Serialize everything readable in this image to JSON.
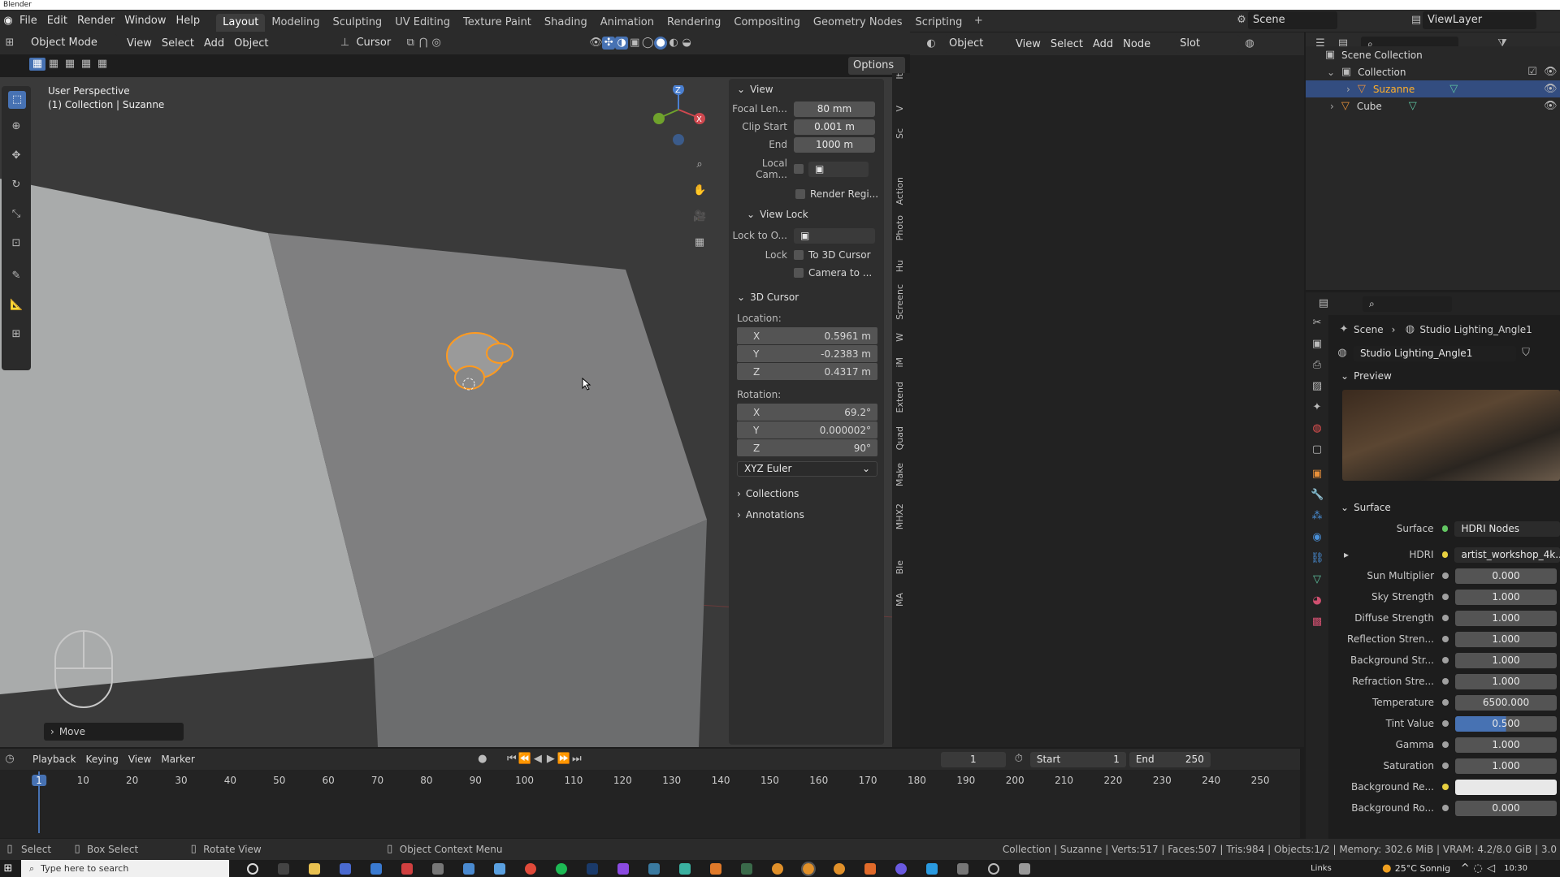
{
  "app_title": "Blender",
  "menus": [
    "File",
    "Edit",
    "Render",
    "Window",
    "Help"
  ],
  "workspaces": [
    "Layout",
    "Modeling",
    "Sculpting",
    "UV Editing",
    "Texture Paint",
    "Shading",
    "Animation",
    "Rendering",
    "Compositing",
    "Geometry Nodes",
    "Scripting"
  ],
  "active_workspace": "Layout",
  "scene_name": "Scene",
  "view_layer": "ViewLayer",
  "viewport_header": {
    "mode": "Object Mode",
    "menus": [
      "View",
      "Select",
      "Add",
      "Object"
    ],
    "pivot": "Cursor",
    "options": "Options"
  },
  "viewport": {
    "perspective": "User Perspective",
    "collection": "(1) Collection | Suzanne",
    "operator": "Move"
  },
  "npanel": {
    "view_title": "View",
    "focal_label": "Focal Len...",
    "focal_value": "80 mm",
    "clip_start_label": "Clip Start",
    "clip_start_value": "0.001 m",
    "end_label": "End",
    "end_value": "1000 m",
    "local_cam_label": "Local Cam...",
    "render_region": "Render Regi...",
    "view_lock_title": "View Lock",
    "lock_to_label": "Lock to O...",
    "lock_label": "Lock",
    "to_3d_cursor": "To 3D Cursor",
    "camera_to": "Camera to ...",
    "cursor_title": "3D Cursor",
    "location_label": "Location:",
    "loc": [
      {
        "axis": "X",
        "value": "0.5961 m"
      },
      {
        "axis": "Y",
        "value": "-0.2383 m"
      },
      {
        "axis": "Z",
        "value": "0.4317 m"
      }
    ],
    "rotation_label": "Rotation:",
    "rot": [
      {
        "axis": "X",
        "value": "69.2°"
      },
      {
        "axis": "Y",
        "value": "0.000002°"
      },
      {
        "axis": "Z",
        "value": "90°"
      }
    ],
    "rot_mode": "XYZ Euler",
    "collections": "Collections",
    "annotations": "Annotations"
  },
  "side_tabs": [
    "It",
    "V",
    "Sc",
    "Action",
    "Photo",
    "Hu",
    "Screenc",
    "W",
    "iM",
    "Extend",
    "Quad",
    "Make",
    "MHX2",
    "Ble",
    "MA"
  ],
  "node_header": {
    "type": "Object",
    "menus": [
      "View",
      "Select",
      "Add",
      "Node"
    ],
    "slot": "Slot"
  },
  "outliner": {
    "root": "Scene Collection",
    "collection": "Collection",
    "items": [
      "Suzanne",
      "Cube"
    ]
  },
  "properties": {
    "breadcrumb_scene": "Scene",
    "breadcrumb_world": "Studio Lighting_Angle1",
    "world_name": "Studio Lighting_Angle1",
    "preview": "Preview",
    "surface_panel": "Surface",
    "surface_label": "Surface",
    "surface_value": "HDRI Nodes",
    "hdri_label": "HDRI",
    "hdri_value": "artist_workshop_4k....",
    "rows": [
      {
        "label": "Sun Multiplier",
        "value": "0.000"
      },
      {
        "label": "Sky Strength",
        "value": "1.000"
      },
      {
        "label": "Diffuse Strength",
        "value": "1.000"
      },
      {
        "label": "Reflection Stren...",
        "value": "1.000"
      },
      {
        "label": "Background Str...",
        "value": "1.000"
      },
      {
        "label": "Refraction Stre...",
        "value": "1.000"
      },
      {
        "label": "Temperature",
        "value": "6500.000"
      },
      {
        "label": "Tint Value",
        "value": "0.500"
      },
      {
        "label": "Gamma",
        "value": "1.000"
      },
      {
        "label": "Saturation",
        "value": "1.000"
      },
      {
        "label": "Background Re...",
        "value": ""
      },
      {
        "label": "Background Ro...",
        "value": "0.000"
      }
    ]
  },
  "timeline": {
    "menus": [
      "Playback",
      "Keying",
      "View",
      "Marker"
    ],
    "current_frame": "1",
    "start_label": "Start",
    "start": "1",
    "end_label": "End",
    "end": "250",
    "ticks": [
      "1",
      "10",
      "20",
      "30",
      "40",
      "50",
      "60",
      "70",
      "80",
      "90",
      "100",
      "110",
      "120",
      "130",
      "140",
      "150",
      "160",
      "170",
      "180",
      "190",
      "200",
      "210",
      "220",
      "230",
      "240",
      "250"
    ]
  },
  "status": {
    "select": "Select",
    "box_select": "Box Select",
    "rotate_view": "Rotate View",
    "context_menu": "Object Context Menu",
    "stats": "Collection | Suzanne | Verts:517 | Faces:507 | Tris:984 | Objects:1/2 | Memory: 302.6 MiB | VRAM: 4.2/8.0 GiB | 3.0"
  },
  "taskbar": {
    "search_placeholder": "Type here to search",
    "links": "Links",
    "weather": "25°C Sonnig",
    "time": "10:30"
  },
  "colors": {
    "accent": "#4772b3",
    "selection": "#ffaa33",
    "panel": "#2b2b2b"
  }
}
